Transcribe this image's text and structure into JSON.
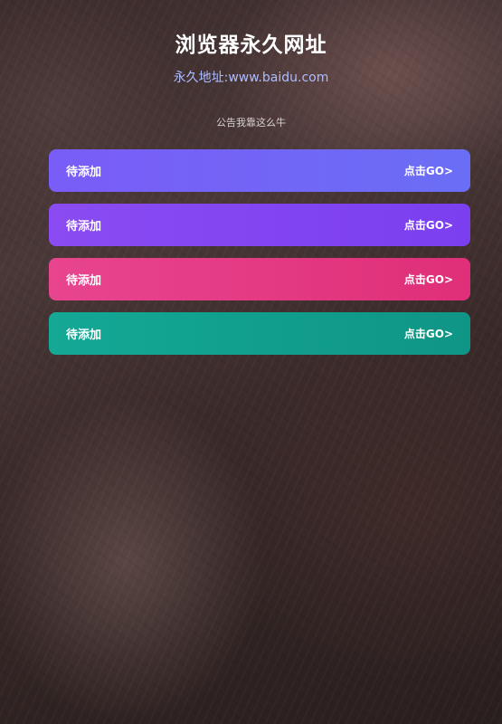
{
  "header": {
    "title": "浏览器永久网址",
    "subtitle": "永久地址:www.baidu.com"
  },
  "notice": "公告我靠这么牛",
  "links": [
    {
      "label": "待添加",
      "action": "点击GO>",
      "color_start": "#7a5cf7",
      "color_end": "#6a6ef5"
    },
    {
      "label": "待添加",
      "action": "点击GO>",
      "color_start": "#8a4bf2",
      "color_end": "#7b3ff0"
    },
    {
      "label": "待添加",
      "action": "点击GO>",
      "color_start": "#e8458f",
      "color_end": "#df2f78"
    },
    {
      "label": "待添加",
      "action": "点击GO>",
      "color_start": "#14a895",
      "color_end": "#0f9585"
    }
  ]
}
